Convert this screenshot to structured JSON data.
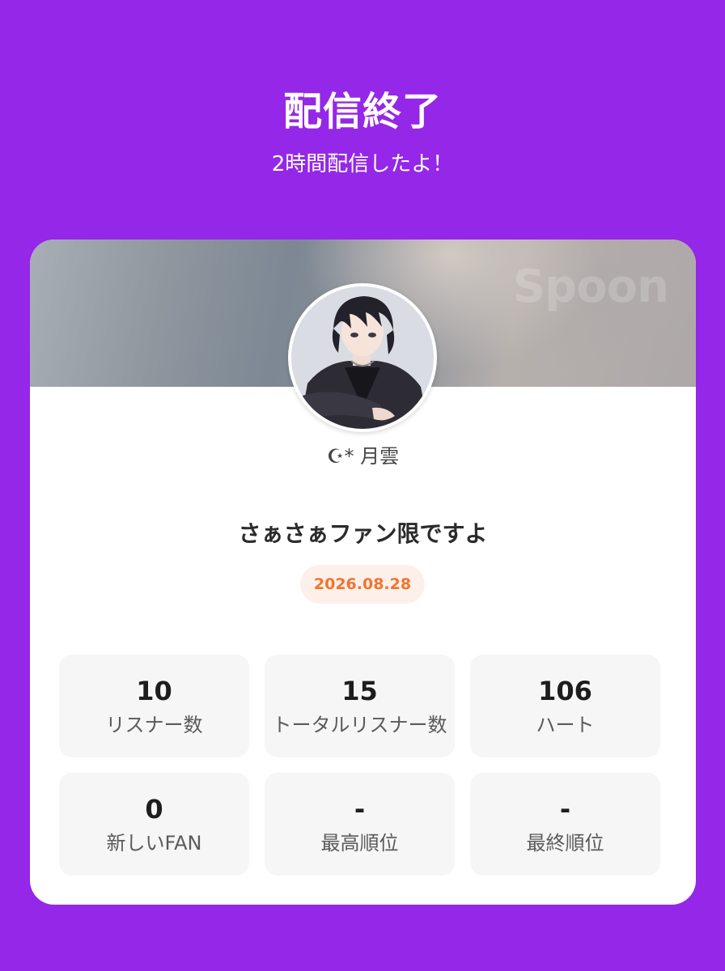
{
  "header": {
    "title": "配信終了",
    "subtitle": "2時間配信したよ！"
  },
  "card": {
    "logo_text": "Spoon",
    "username": "☪︎* 月雲",
    "stream_title": "さぁさぁファン限ですよ",
    "date": "2026.08.28",
    "stats": [
      {
        "value": "10",
        "label": "リスナー数"
      },
      {
        "value": "15",
        "label": "トータルリスナー数"
      },
      {
        "value": "106",
        "label": "ハート"
      },
      {
        "value": "0",
        "label": "新しいFAN"
      },
      {
        "value": "-",
        "label": "最高順位"
      },
      {
        "value": "-",
        "label": "最終順位"
      }
    ]
  },
  "colors": {
    "background": "#9427e8",
    "date_text": "#f2742e",
    "date_bg": "#fdf0ea"
  }
}
